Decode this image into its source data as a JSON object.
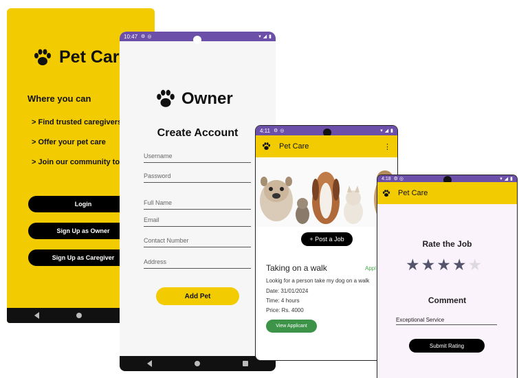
{
  "landing": {
    "brand": "Pet Care",
    "tagline": "Where you can",
    "features": [
      "> Find trusted caregivers",
      "> Offer your pet care",
      "> Join our community to"
    ],
    "buttons": {
      "login": "Login",
      "signup_owner": "Sign Up as Owner",
      "signup_caregiver": "Sign Up as Caregiver"
    }
  },
  "register": {
    "status_time": "10:47",
    "title": "Owner",
    "subtitle": "Create Account",
    "fields": {
      "username": "Username",
      "password": "Password",
      "full_name": "Full Name",
      "email": "Email",
      "contact": "Contact Number",
      "address": "Address"
    },
    "submit_label": "Add Pet"
  },
  "jobs": {
    "status_time": "4:11",
    "app_title": "Pet Care",
    "post_job_label": "+ Post a Job",
    "job": {
      "title": "Taking on a walk",
      "status": "Appl",
      "description": "Lookig for a person take my dog on a walk",
      "date": "Date: 31/01/2024",
      "time": "Time: 4 hours",
      "price": "Price: Rs. 4000"
    },
    "view_applicant_label": "View Applicant"
  },
  "rating": {
    "status_time": "4:18",
    "app_title": "Pet Care",
    "rate_title": "Rate the Job",
    "stars_filled": 4,
    "stars_total": 5,
    "comment_title": "Comment",
    "comment_value": "Exceptional Service",
    "submit_label": "Submit Rating"
  },
  "colors": {
    "brand_yellow": "#f2cc00",
    "status_purple": "#6c4fa8",
    "view_green": "#3d9448",
    "star_filled": "#54556d"
  },
  "icons": [
    "paw-icon",
    "wifi-icon",
    "signal-icon",
    "battery-icon",
    "gear-icon",
    "more-vert-icon",
    "star-icon",
    "back-nav-icon",
    "home-nav-icon",
    "recents-nav-icon"
  ]
}
